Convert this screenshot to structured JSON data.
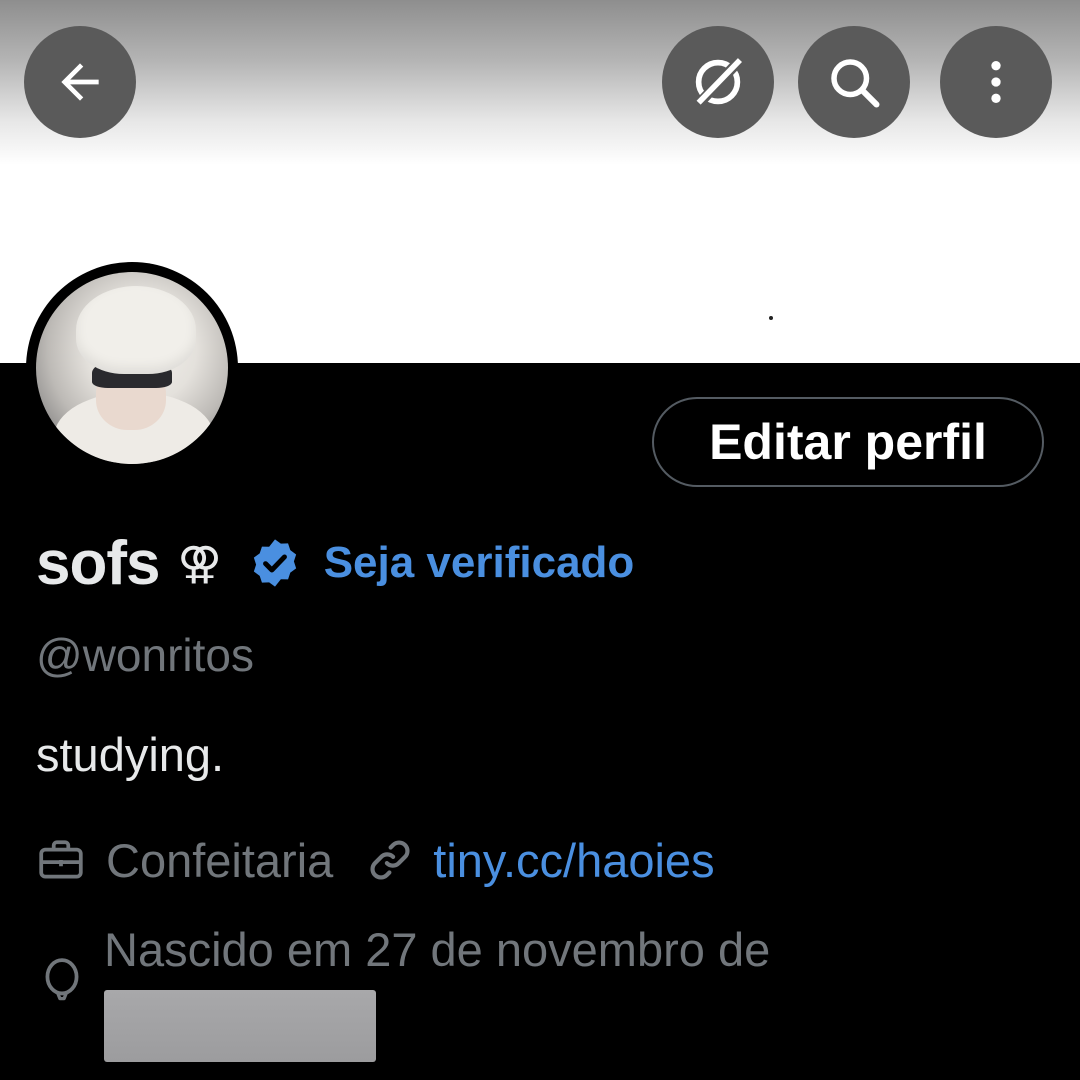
{
  "header": {
    "back_icon": "arrow-left-icon",
    "grok_icon": "grok-icon",
    "search_icon": "search-icon",
    "more_icon": "more-vertical-icon"
  },
  "profile": {
    "display_name": "sofs",
    "name_emoji": "⚢",
    "verified_icon": "verified-badge-icon",
    "get_verified_label": "Seja verificado",
    "handle": "@wonritos",
    "bio": "studying.",
    "edit_button_label": "Editar perfil",
    "profession": "Confeitaria",
    "link": "tiny.cc/haoies",
    "birth_text": "Nascido em 27 de novembro de"
  },
  "colors": {
    "background": "#000000",
    "text_primary": "#e7e9ea",
    "text_secondary": "#71767b",
    "accent": "#4a8fe0",
    "top_button": "#5a5a5a"
  }
}
